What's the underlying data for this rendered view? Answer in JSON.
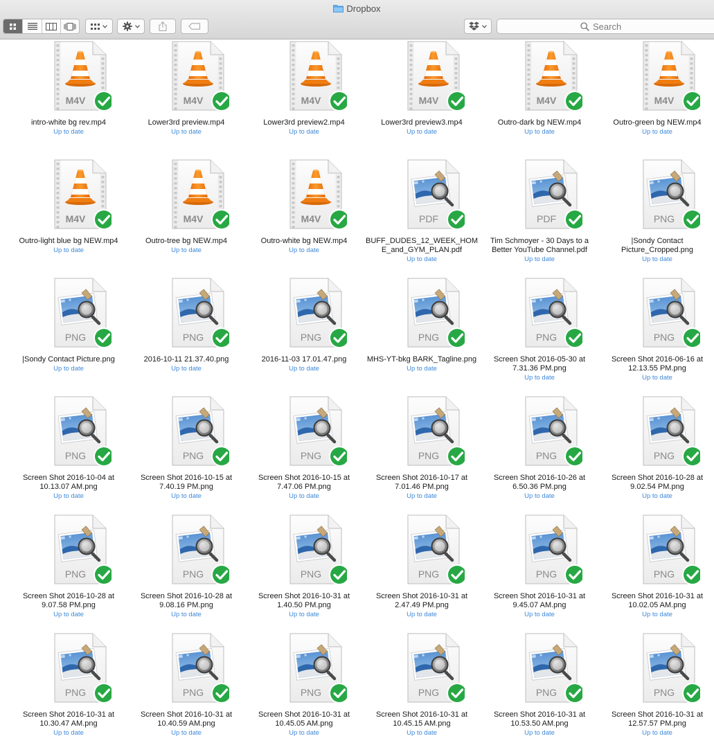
{
  "window": {
    "title": "Dropbox"
  },
  "toolbar": {
    "search_placeholder": "Search"
  },
  "files": [
    {
      "name": "intro-white bg rev.mp4",
      "type": "M4V",
      "kind": "video",
      "status": "Up to date"
    },
    {
      "name": "Lower3rd preview.mp4",
      "type": "M4V",
      "kind": "video",
      "status": "Up to date"
    },
    {
      "name": "Lower3rd preview2.mp4",
      "type": "M4V",
      "kind": "video",
      "status": "Up to date"
    },
    {
      "name": "Lower3rd preview3.mp4",
      "type": "M4V",
      "kind": "video",
      "status": "Up to date"
    },
    {
      "name": "Outro-dark bg NEW.mp4",
      "type": "M4V",
      "kind": "video",
      "status": "Up to date"
    },
    {
      "name": "Outro-green bg NEW.mp4",
      "type": "M4V",
      "kind": "video",
      "status": "Up to date"
    },
    {
      "name": "Outro-light blue bg NEW.mp4",
      "type": "M4V",
      "kind": "video",
      "status": "Up to date"
    },
    {
      "name": "Outro-tree bg NEW.mp4",
      "type": "M4V",
      "kind": "video",
      "status": "Up to date"
    },
    {
      "name": "Outro-white bg NEW.mp4",
      "type": "M4V",
      "kind": "video",
      "status": "Up to date"
    },
    {
      "name": "BUFF_DUDES_12_WEEK_HOME_and_GYM_PLAN.pdf",
      "type": "PDF",
      "kind": "image",
      "status": "Up to date"
    },
    {
      "name": "Tim Schmoyer - 30 Days to a Better YouTube Channel.pdf",
      "type": "PDF",
      "kind": "image",
      "status": "Up to date"
    },
    {
      "name": "|Sondy Contact Picture_Cropped.png",
      "type": "PNG",
      "kind": "image",
      "status": "Up to date"
    },
    {
      "name": "|Sondy Contact Picture.png",
      "type": "PNG",
      "kind": "image",
      "status": "Up to date"
    },
    {
      "name": "2016-10-11 21.37.40.png",
      "type": "PNG",
      "kind": "image",
      "status": "Up to date"
    },
    {
      "name": "2016-11-03 17.01.47.png",
      "type": "PNG",
      "kind": "image",
      "status": "Up to date"
    },
    {
      "name": "MHS-YT-bkg BARK_Tagline.png",
      "type": "PNG",
      "kind": "image",
      "status": "Up to date"
    },
    {
      "name": "Screen Shot 2016-05-30 at 7.31.36 PM.png",
      "type": "PNG",
      "kind": "image",
      "status": "Up to date"
    },
    {
      "name": "Screen Shot 2016-06-16 at 12.13.55 PM.png",
      "type": "PNG",
      "kind": "image",
      "status": "Up to date"
    },
    {
      "name": "Screen Shot 2016-10-04 at 10.13.07 AM.png",
      "type": "PNG",
      "kind": "image",
      "status": "Up to date"
    },
    {
      "name": "Screen Shot 2016-10-15 at 7.40.19 PM.png",
      "type": "PNG",
      "kind": "image",
      "status": "Up to date"
    },
    {
      "name": "Screen Shot 2016-10-15 at 7.47.06 PM.png",
      "type": "PNG",
      "kind": "image",
      "status": "Up to date"
    },
    {
      "name": "Screen Shot 2016-10-17 at 7.01.46 PM.png",
      "type": "PNG",
      "kind": "image",
      "status": "Up to date"
    },
    {
      "name": "Screen Shot 2016-10-26 at 6.50.36 PM.png",
      "type": "PNG",
      "kind": "image",
      "status": "Up to date"
    },
    {
      "name": "Screen Shot 2016-10-28 at 9.02.54 PM.png",
      "type": "PNG",
      "kind": "image",
      "status": "Up to date"
    },
    {
      "name": "Screen Shot 2016-10-28 at 9.07.58 PM.png",
      "type": "PNG",
      "kind": "image",
      "status": "Up to date"
    },
    {
      "name": "Screen Shot 2016-10-28 at 9.08.16 PM.png",
      "type": "PNG",
      "kind": "image",
      "status": "Up to date"
    },
    {
      "name": "Screen Shot 2016-10-31 at 1.40.50 PM.png",
      "type": "PNG",
      "kind": "image",
      "status": "Up to date"
    },
    {
      "name": "Screen Shot 2016-10-31 at 2.47.49 PM.png",
      "type": "PNG",
      "kind": "image",
      "status": "Up to date"
    },
    {
      "name": "Screen Shot 2016-10-31 at 9.45.07 AM.png",
      "type": "PNG",
      "kind": "image",
      "status": "Up to date"
    },
    {
      "name": "Screen Shot 2016-10-31 at 10.02.05 AM.png",
      "type": "PNG",
      "kind": "image",
      "status": "Up to date"
    },
    {
      "name": "Screen Shot 2016-10-31 at 10.30.47 AM.png",
      "type": "PNG",
      "kind": "image",
      "status": "Up to date"
    },
    {
      "name": "Screen Shot 2016-10-31 at 10.40.59 AM.png",
      "type": "PNG",
      "kind": "image",
      "status": "Up to date"
    },
    {
      "name": "Screen Shot 2016-10-31 at 10.45.05 AM.png",
      "type": "PNG",
      "kind": "image",
      "status": "Up to date"
    },
    {
      "name": "Screen Shot 2016-10-31 at 10.45.15 AM.png",
      "type": "PNG",
      "kind": "image",
      "status": "Up to date"
    },
    {
      "name": "Screen Shot 2016-10-31 at 10.53.50 AM.png",
      "type": "PNG",
      "kind": "image",
      "status": "Up to date"
    },
    {
      "name": "Screen Shot 2016-10-31 at 12.57.57 PM.png",
      "type": "PNG",
      "kind": "image",
      "status": "Up to date"
    }
  ],
  "colors": {
    "sync_check": "#27a844",
    "status_text": "#3e88d8",
    "vlc_orange": "#f08a16"
  }
}
